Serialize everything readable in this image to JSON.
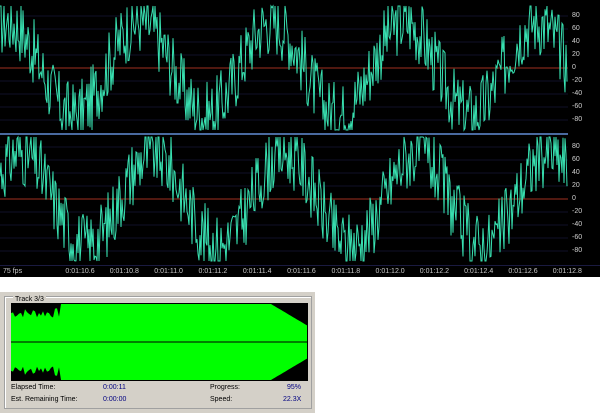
{
  "editor": {
    "fps_label": "75 fps",
    "y_axis_labels": [
      "80",
      "60",
      "40",
      "20",
      "0",
      "-20",
      "-40",
      "-60",
      "-80"
    ],
    "time_labels": [
      "0:01:10.6",
      "0:01:10.8",
      "0:01:11.0",
      "0:01:11.2",
      "0:01:11.4",
      "0:01:11.6",
      "0:01:11.8",
      "0:01:12.0",
      "0:01:12.2",
      "0:01:12.4",
      "0:01:12.6",
      "0:01:12.8"
    ],
    "colors": {
      "background": "#000000",
      "waveform": "#38e0b0",
      "center_line": "#a03020",
      "grid": "#303070"
    }
  },
  "track_panel": {
    "title": "Track 3/3",
    "elapsed_label": "Elapsed Time:",
    "elapsed_value": "0:00:11",
    "remaining_label": "Est. Remaining Time:",
    "remaining_value": "0:00:00",
    "progress_label": "Progress:",
    "progress_value": "95%",
    "speed_label": "Speed:",
    "speed_value": "22.3X",
    "colors": {
      "overview_fill": "#00ff00",
      "overview_bg": "#000000"
    }
  }
}
